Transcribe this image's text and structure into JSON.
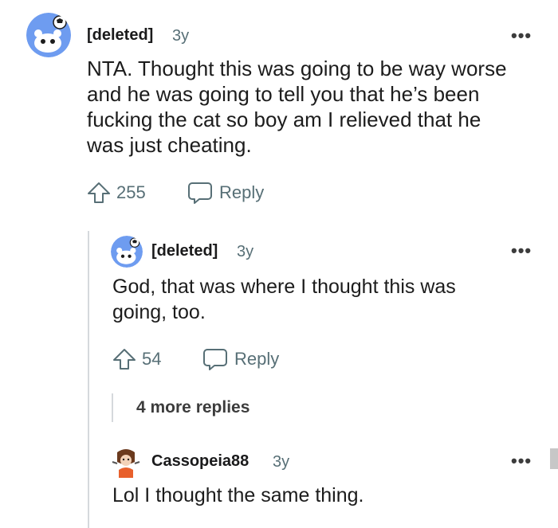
{
  "comments": [
    {
      "username": "[deleted]",
      "age": "3y",
      "text_lines": [
        "NTA. Thought this was going to be way worse",
        "and he was going to tell you that he’s been",
        "fucking the cat so boy am I relieved that he",
        "was just cheating."
      ],
      "upvotes": "255",
      "reply_label": "Reply",
      "more_icon": "more-options-icon"
    },
    {
      "username": "[deleted]",
      "age": "3y",
      "text_lines": [
        "God, that was where I thought this was",
        "going, too."
      ],
      "upvotes": "54",
      "reply_label": "Reply",
      "more_replies": "4 more replies"
    },
    {
      "username": "Cassopeia88",
      "age": "3y",
      "text_lines": [
        "Lol I thought the same thing."
      ]
    }
  ],
  "icons": {
    "avatar": "reddit-snoo-avatar-icon",
    "upvote": "upvote-arrow-icon",
    "reply": "reply-bubble-icon",
    "more": "more-options-icon"
  },
  "colors": {
    "avatar_bg": "#6e9cf0",
    "text": "#1c1c1c",
    "meta": "#576f76",
    "thread_line": "#d5d9dc"
  }
}
